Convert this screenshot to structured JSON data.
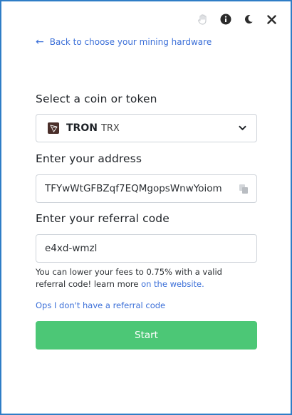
{
  "topbar": {
    "icons": [
      "hand-icon",
      "info-icon",
      "moon-icon",
      "close-icon"
    ]
  },
  "back_link": {
    "label": "Back to choose your mining hardware"
  },
  "coin": {
    "section_label": "Select a coin or token",
    "name": "TRON",
    "ticker": "TRX"
  },
  "address": {
    "section_label": "Enter your address",
    "value": "TFYwWtGFBZqf7EQMgopsWnwYoiom"
  },
  "referral": {
    "section_label": "Enter your referral code",
    "value": "e4xd-wmzl",
    "helper_text": "You can lower your fees to 0.75% with a valid referral code! learn more",
    "helper_link": "on the website.",
    "no_code_link": "Ops I don't have a referral code"
  },
  "start_button": {
    "label": "Start"
  },
  "colors": {
    "accent_blue": "#3b6fd8",
    "start_green": "#4cc776",
    "window_border": "#2f7dc6"
  }
}
